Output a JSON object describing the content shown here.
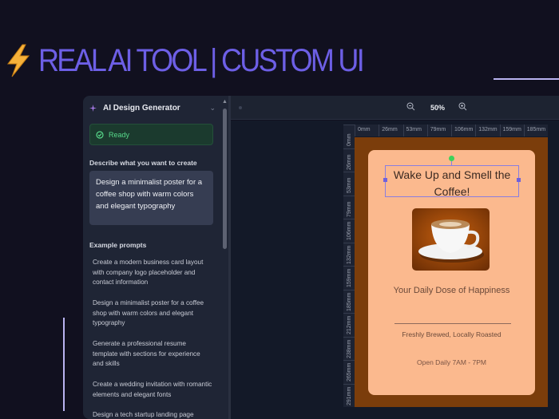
{
  "headline": {
    "text": "REAL AI TOOL | CUSTOM UI",
    "icon": "lightning-bolt-icon"
  },
  "panel": {
    "title": "AI Design Generator",
    "status": "Ready",
    "describe_label": "Describe what you want to create",
    "prompt_value": "Design a minimalist poster for a coffee shop with warm colors and elegant typography",
    "examples_label": "Example prompts",
    "examples": [
      "Create a modern business card layout with company logo placeholder and contact information",
      "Design a minimalist poster for a coffee shop with warm colors and elegant typography",
      "Generate a professional resume template with sections for experience and skills",
      "Create a wedding invitation with romantic elements and elegant fonts",
      "Design a tech startup landing page"
    ]
  },
  "toolbar": {
    "zoom": "50%"
  },
  "ruler": {
    "top": [
      "0mm",
      "26mm",
      "53mm",
      "79mm",
      "106mm",
      "132mm",
      "159mm",
      "185mm"
    ],
    "left": [
      "0mm",
      "26mm",
      "53mm",
      "79mm",
      "106mm",
      "132mm",
      "159mm",
      "185mm",
      "212mm",
      "238mm",
      "265mm",
      "291mm"
    ]
  },
  "poster": {
    "title": "Wake Up and Smell the Coffee!",
    "subtitle": "Your Daily Dose of Happiness",
    "tagline": "Freshly Brewed, Locally Roasted",
    "hours": "Open Daily 7AM - 7PM",
    "colors": {
      "background": "#7b3d0b",
      "card": "#fbb98e"
    }
  }
}
